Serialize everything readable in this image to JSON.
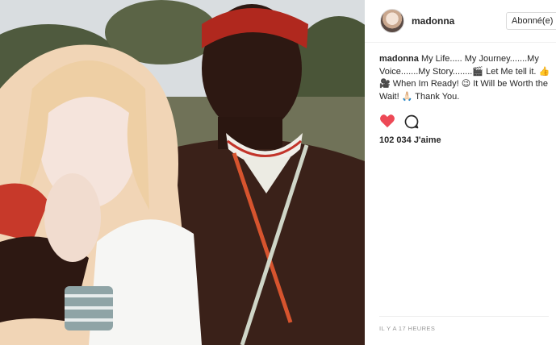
{
  "post": {
    "image_alt_subject": "photo-post",
    "header": {
      "username": "madonna",
      "follow_label": "Abonné(e)"
    },
    "caption": {
      "username": "madonna",
      "text": " My Life..... My Journey.......My Voice.......My Story........🎬 Let Me tell it. 👍 🎥 When Im Ready! 😉 It Will be Worth the Wait! 🙏🏻 Thank You."
    },
    "actions": {
      "liked": true,
      "like_color": "#ed4956"
    },
    "likes_text": "102 034 J'aime",
    "timestamp": "IL Y A 17 HEURES"
  }
}
